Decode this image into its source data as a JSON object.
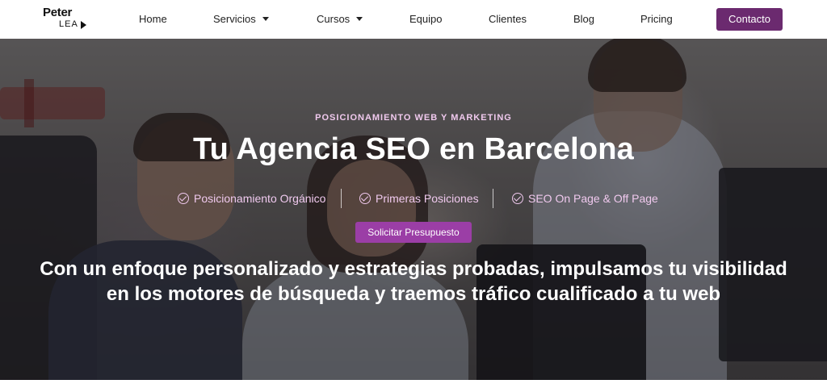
{
  "header": {
    "logo": {
      "top": "Peter",
      "bottom": "LEA"
    },
    "nav": [
      {
        "label": "Home"
      },
      {
        "label": "Servicios"
      },
      {
        "label": "Cursos"
      },
      {
        "label": "Equipo"
      },
      {
        "label": "Clientes"
      },
      {
        "label": "Blog"
      },
      {
        "label": "Pricing"
      }
    ],
    "contact_label": "Contacto"
  },
  "hero": {
    "kicker": "POSICIONAMIENTO WEB Y MARKETING",
    "title": "Tu Agencia SEO en Barcelona",
    "features": [
      {
        "label": "Posicionamiento Orgánico",
        "icon": "check-circle-icon"
      },
      {
        "label": "Primeras Posiciones",
        "icon": "check-circle-icon"
      },
      {
        "label": "SEO On Page & Off Page",
        "icon": "check-circle-icon"
      }
    ],
    "cta_label": "Solicitar Presupuesto",
    "subtitle": "Con un enfoque personalizado y estrategias probadas, impulsamos tu visibilidad en los motores de búsqueda y traemos tráfico cualificado a tu web"
  },
  "colors": {
    "brand": "#6b2a6f",
    "cta": "#9b3ea6",
    "accent_text": "#f0c9ee"
  }
}
